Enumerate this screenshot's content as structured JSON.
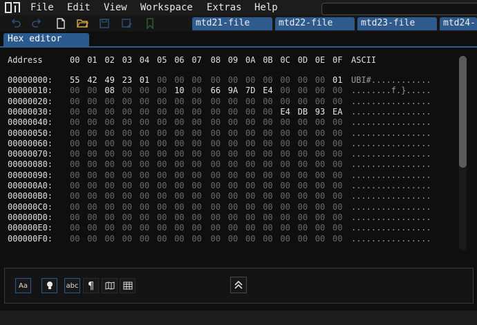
{
  "app": {
    "menu": [
      "File",
      "Edit",
      "View",
      "Workspace",
      "Extras",
      "Help"
    ]
  },
  "toolbar": {
    "icons": [
      "undo-icon",
      "redo-icon",
      "new-file-icon",
      "open-folder-icon",
      "save-icon",
      "save-as-icon",
      "bookmark-icon"
    ]
  },
  "file_tabs": [
    "mtd21-file",
    "mtd22-file",
    "mtd23-file",
    "mtd24-"
  ],
  "panel": {
    "title": "Hex editor"
  },
  "hex": {
    "address_label": "Address",
    "columns": [
      "00",
      "01",
      "02",
      "03",
      "04",
      "05",
      "06",
      "07",
      "08",
      "09",
      "0A",
      "0B",
      "0C",
      "0D",
      "0E",
      "0F"
    ],
    "ascii_label": "ASCII",
    "rows": [
      {
        "addr": "00000000:",
        "bytes": [
          "55",
          "42",
          "49",
          "23",
          "01",
          "00",
          "00",
          "00",
          "00",
          "00",
          "00",
          "00",
          "00",
          "00",
          "00",
          "01"
        ],
        "ascii": "UBI#............"
      },
      {
        "addr": "00000010:",
        "bytes": [
          "00",
          "00",
          "08",
          "00",
          "00",
          "00",
          "10",
          "00",
          "66",
          "9A",
          "7D",
          "E4",
          "00",
          "00",
          "00",
          "00"
        ],
        "ascii": "........f.}....."
      },
      {
        "addr": "00000020:",
        "bytes": [
          "00",
          "00",
          "00",
          "00",
          "00",
          "00",
          "00",
          "00",
          "00",
          "00",
          "00",
          "00",
          "00",
          "00",
          "00",
          "00"
        ],
        "ascii": "................"
      },
      {
        "addr": "00000030:",
        "bytes": [
          "00",
          "00",
          "00",
          "00",
          "00",
          "00",
          "00",
          "00",
          "00",
          "00",
          "00",
          "00",
          "E4",
          "DB",
          "93",
          "EA"
        ],
        "ascii": "................"
      },
      {
        "addr": "00000040:",
        "bytes": [
          "00",
          "00",
          "00",
          "00",
          "00",
          "00",
          "00",
          "00",
          "00",
          "00",
          "00",
          "00",
          "00",
          "00",
          "00",
          "00"
        ],
        "ascii": "................"
      },
      {
        "addr": "00000050:",
        "bytes": [
          "00",
          "00",
          "00",
          "00",
          "00",
          "00",
          "00",
          "00",
          "00",
          "00",
          "00",
          "00",
          "00",
          "00",
          "00",
          "00"
        ],
        "ascii": "................"
      },
      {
        "addr": "00000060:",
        "bytes": [
          "00",
          "00",
          "00",
          "00",
          "00",
          "00",
          "00",
          "00",
          "00",
          "00",
          "00",
          "00",
          "00",
          "00",
          "00",
          "00"
        ],
        "ascii": "................"
      },
      {
        "addr": "00000070:",
        "bytes": [
          "00",
          "00",
          "00",
          "00",
          "00",
          "00",
          "00",
          "00",
          "00",
          "00",
          "00",
          "00",
          "00",
          "00",
          "00",
          "00"
        ],
        "ascii": "................"
      },
      {
        "addr": "00000080:",
        "bytes": [
          "00",
          "00",
          "00",
          "00",
          "00",
          "00",
          "00",
          "00",
          "00",
          "00",
          "00",
          "00",
          "00",
          "00",
          "00",
          "00"
        ],
        "ascii": "................"
      },
      {
        "addr": "00000090:",
        "bytes": [
          "00",
          "00",
          "00",
          "00",
          "00",
          "00",
          "00",
          "00",
          "00",
          "00",
          "00",
          "00",
          "00",
          "00",
          "00",
          "00"
        ],
        "ascii": "................"
      },
      {
        "addr": "000000A0:",
        "bytes": [
          "00",
          "00",
          "00",
          "00",
          "00",
          "00",
          "00",
          "00",
          "00",
          "00",
          "00",
          "00",
          "00",
          "00",
          "00",
          "00"
        ],
        "ascii": "................"
      },
      {
        "addr": "000000B0:",
        "bytes": [
          "00",
          "00",
          "00",
          "00",
          "00",
          "00",
          "00",
          "00",
          "00",
          "00",
          "00",
          "00",
          "00",
          "00",
          "00",
          "00"
        ],
        "ascii": "................"
      },
      {
        "addr": "000000C0:",
        "bytes": [
          "00",
          "00",
          "00",
          "00",
          "00",
          "00",
          "00",
          "00",
          "00",
          "00",
          "00",
          "00",
          "00",
          "00",
          "00",
          "00"
        ],
        "ascii": "................"
      },
      {
        "addr": "000000D0:",
        "bytes": [
          "00",
          "00",
          "00",
          "00",
          "00",
          "00",
          "00",
          "00",
          "00",
          "00",
          "00",
          "00",
          "00",
          "00",
          "00",
          "00"
        ],
        "ascii": "................"
      },
      {
        "addr": "000000E0:",
        "bytes": [
          "00",
          "00",
          "00",
          "00",
          "00",
          "00",
          "00",
          "00",
          "00",
          "00",
          "00",
          "00",
          "00",
          "00",
          "00",
          "00"
        ],
        "ascii": "................"
      },
      {
        "addr": "000000F0:",
        "bytes": [
          "00",
          "00",
          "00",
          "00",
          "00",
          "00",
          "00",
          "00",
          "00",
          "00",
          "00",
          "00",
          "00",
          "00",
          "00",
          "00"
        ],
        "ascii": "................"
      }
    ]
  },
  "footer": {
    "case_button": "Aa",
    "spell_button": "abc",
    "pilcrow": "¶",
    "icons": [
      "lightbulb-icon",
      "map-icon",
      "table-icon",
      "collapse-up-icon"
    ]
  },
  "colors": {
    "accent": "#2b5a8f",
    "background": "#0f0f0f",
    "zero_byte": "#6a6a6a",
    "nonzero_byte": "#e8e8e8"
  }
}
